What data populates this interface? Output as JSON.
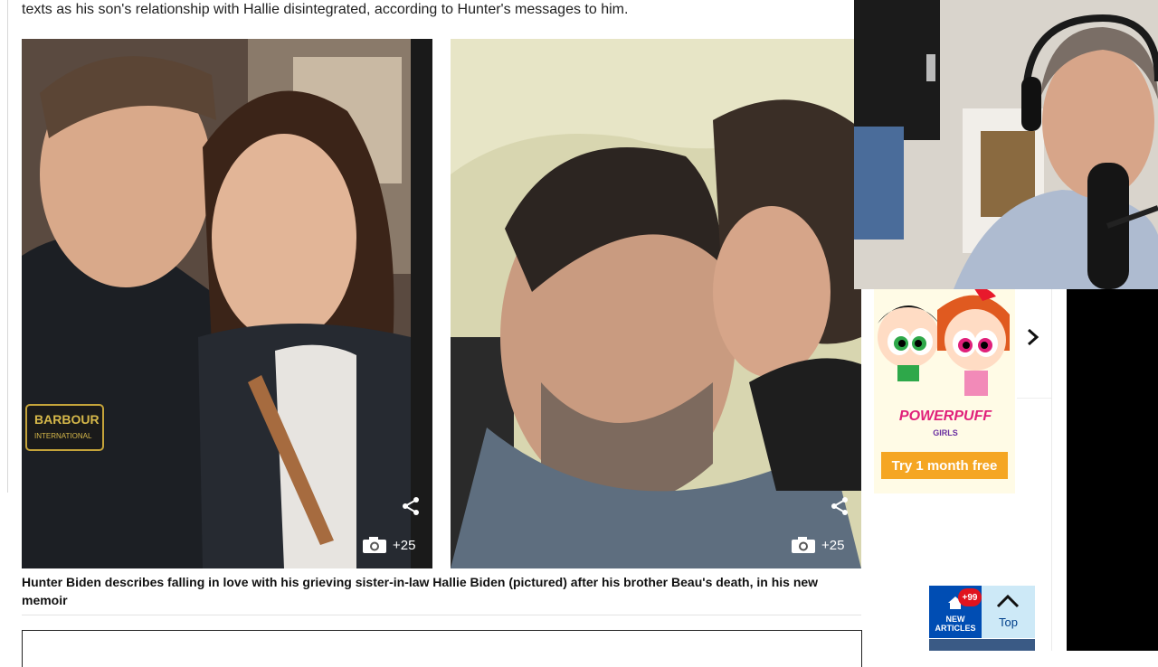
{
  "article": {
    "lead_text": "texts as his son's relationship with Hallie disintegrated, according to Hunter's messages to him.",
    "caption": "Hunter Biden describes falling in love with his grieving sister-in-law Hallie Biden (pictured) after his brother Beau's death, in his new memoir",
    "photos": [
      {
        "gallery_count": "+25",
        "share_icon": "share-icon",
        "camera_icon": "camera-icon"
      },
      {
        "gallery_count": "+25",
        "share_icon": "share-icon",
        "camera_icon": "camera-icon"
      }
    ]
  },
  "ad": {
    "brand": "POWERPUFF",
    "sub": "GIRLS",
    "cta": "Try 1 month free",
    "next_icon": "chevron-right-icon"
  },
  "nav": {
    "new_articles_label_1": "NEW",
    "new_articles_label_2": "ARTICLES",
    "new_articles_badge": "+99",
    "top_label": "Top",
    "home_icon": "home-icon",
    "top_icon": "chevron-up-icon"
  },
  "colors": {
    "nav_blue": "#004db3",
    "badge_red": "#e0131e",
    "top_bg": "#cde9f7",
    "cta_orange": "#f5a623"
  }
}
